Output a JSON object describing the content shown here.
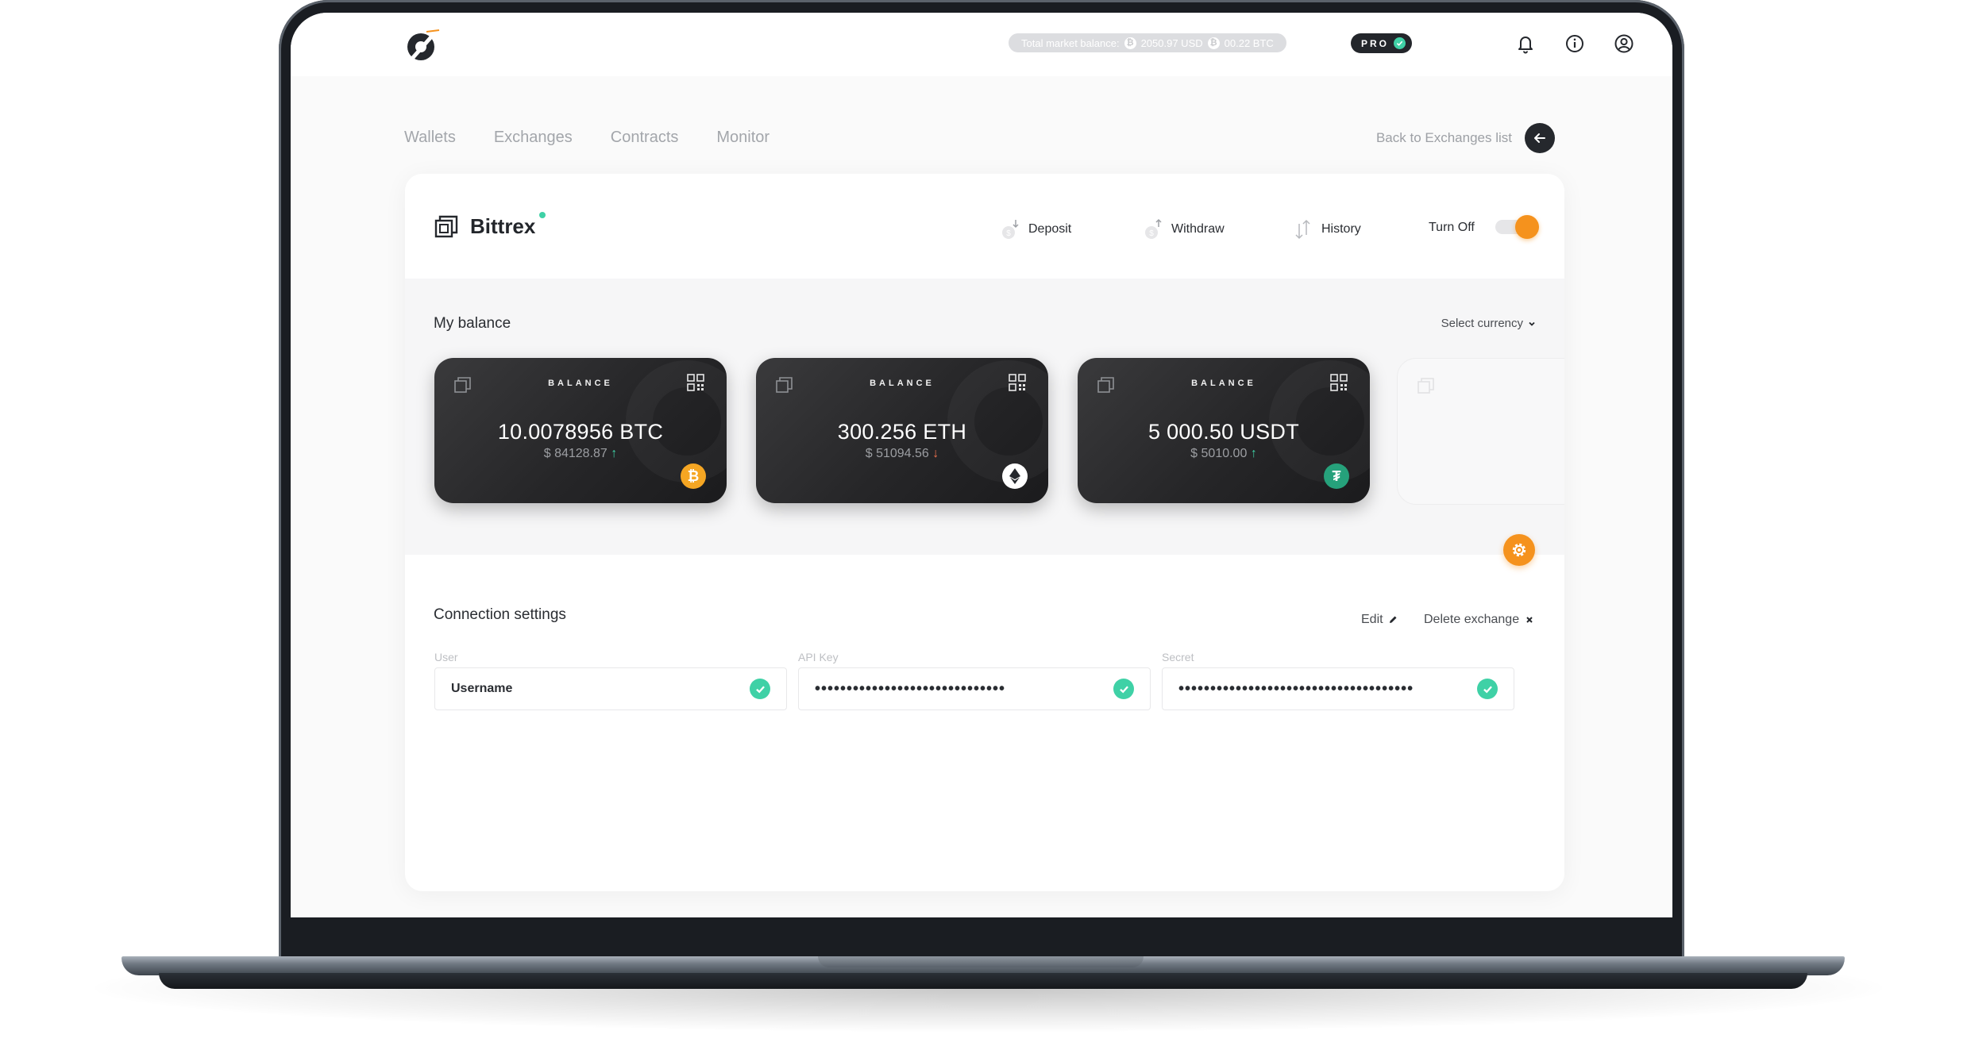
{
  "header": {
    "market_label": "Total market balance:",
    "market_usd": "2050.97 USD",
    "market_btc": "00.22 BTC",
    "pro_label": "PRO"
  },
  "nav": {
    "tabs": [
      "Wallets",
      "Exchanges",
      "Contracts",
      "Monitor"
    ],
    "back_label": "Back to Exchanges list"
  },
  "exchange": {
    "name": "Bittrex",
    "actions": {
      "deposit": "Deposit",
      "withdraw": "Withdraw",
      "history": "History"
    },
    "toggle_label": "Turn Off",
    "toggle_on": true
  },
  "balance": {
    "title": "My balance",
    "select_currency": "Select currency",
    "cards": [
      {
        "label": "BALANCE",
        "amount": "10.0078956 BTC",
        "usd": "$ 84128.87",
        "trend": "up",
        "trend_glyph": "↑",
        "coin_icon": "bitcoin-icon",
        "coin_color": "#f5a623"
      },
      {
        "label": "BALANCE",
        "amount": "300.256 ETH",
        "usd": "$ 51094.56",
        "trend": "down",
        "trend_glyph": "↓",
        "coin_icon": "ethereum-icon",
        "coin_color": "#ffffff"
      },
      {
        "label": "BALANCE",
        "amount": "5 000.50 USDT",
        "usd": "$ 5010.00",
        "trend": "up",
        "trend_glyph": "↑",
        "coin_icon": "tether-icon",
        "coin_color": "#26a17b"
      }
    ]
  },
  "connection": {
    "title": "Connection settings",
    "edit_label": "Edit",
    "delete_label": "Delete exchange",
    "fields": [
      {
        "label": "User",
        "value": "Username"
      },
      {
        "label": "API Key",
        "value": "••••••••••••••••••••••••••••••"
      },
      {
        "label": "Secret",
        "value": "•••••••••••••••••••••••••••••••••••••"
      }
    ]
  },
  "colors": {
    "accent": "#f5921d",
    "success": "#3fd1a6",
    "dark": "#23262b"
  }
}
